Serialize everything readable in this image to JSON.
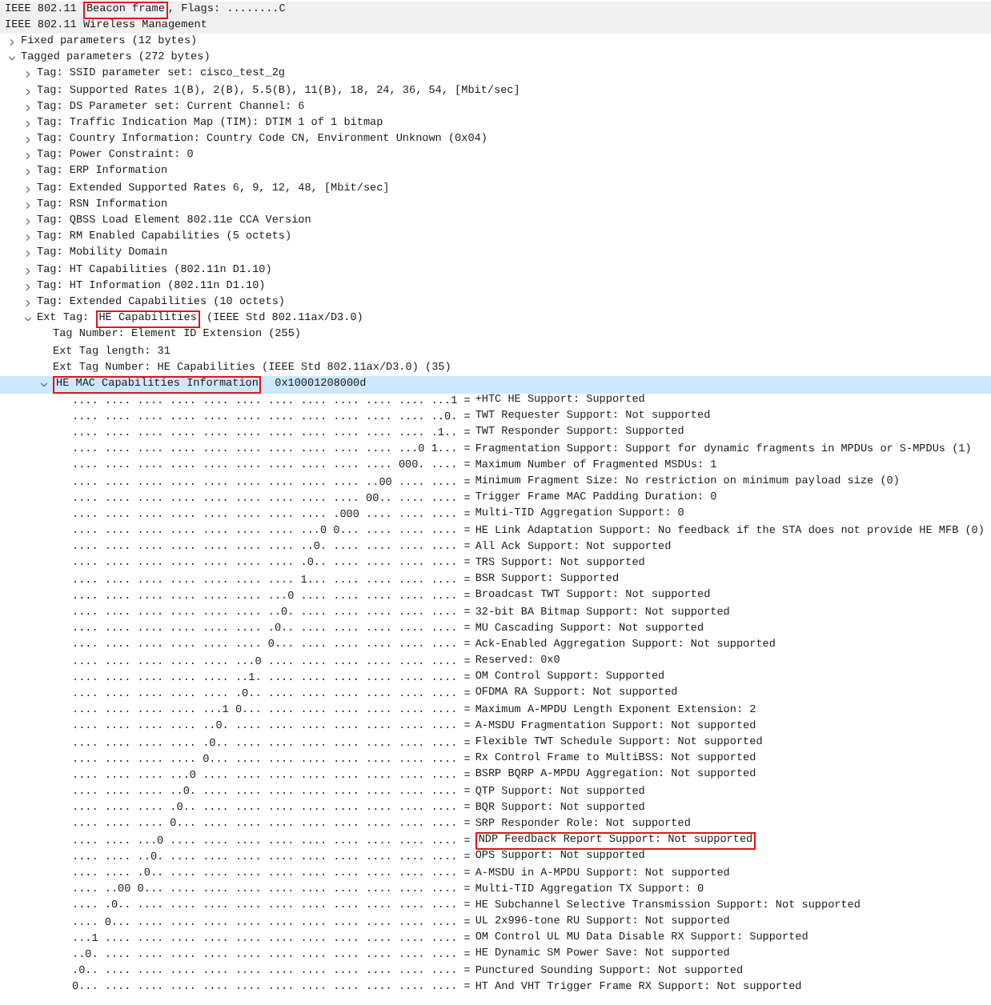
{
  "headers": [
    {
      "shaded": true,
      "parts": [
        {
          "text": "IEEE 802.11 ",
          "boxed": false
        },
        {
          "text": "Beacon frame",
          "boxed": true
        },
        {
          "text": ", Flags: ........C",
          "boxed": false
        }
      ]
    },
    {
      "shaded": true,
      "parts": [
        {
          "text": "IEEE 802.11 Wireless Management",
          "boxed": false
        }
      ]
    }
  ],
  "tree": [
    {
      "selected": false,
      "expanded": false,
      "parts": [
        {
          "text": "Fixed parameters (12 bytes)",
          "boxed": false
        }
      ]
    },
    {
      "selected": false,
      "expanded": true,
      "parts": [
        {
          "text": "Tagged parameters (272 bytes)",
          "boxed": false
        }
      ],
      "children": [
        {
          "selected": false,
          "expanded": false,
          "parts": [
            {
              "text": "Tag: SSID parameter set: cisco_test_2g",
              "boxed": false
            }
          ]
        },
        {
          "selected": false,
          "expanded": false,
          "parts": [
            {
              "text": "Tag: Supported Rates 1(B), 2(B), 5.5(B), 11(B), 18, 24, 36, 54, [Mbit/sec]",
              "boxed": false
            }
          ]
        },
        {
          "selected": false,
          "expanded": false,
          "parts": [
            {
              "text": "Tag: DS Parameter set: Current Channel: 6",
              "boxed": false
            }
          ]
        },
        {
          "selected": false,
          "expanded": false,
          "parts": [
            {
              "text": "Tag: Traffic Indication Map (TIM): DTIM 1 of 1 bitmap",
              "boxed": false
            }
          ]
        },
        {
          "selected": false,
          "expanded": false,
          "parts": [
            {
              "text": "Tag: Country Information: Country Code CN, Environment Unknown (0x04)",
              "boxed": false
            }
          ]
        },
        {
          "selected": false,
          "expanded": false,
          "parts": [
            {
              "text": "Tag: Power Constraint: 0",
              "boxed": false
            }
          ]
        },
        {
          "selected": false,
          "expanded": false,
          "parts": [
            {
              "text": "Tag: ERP Information",
              "boxed": false
            }
          ]
        },
        {
          "selected": false,
          "expanded": false,
          "parts": [
            {
              "text": "Tag: Extended Supported Rates 6, 9, 12, 48, [Mbit/sec]",
              "boxed": false
            }
          ]
        },
        {
          "selected": false,
          "expanded": false,
          "parts": [
            {
              "text": "Tag: RSN Information",
              "boxed": false
            }
          ]
        },
        {
          "selected": false,
          "expanded": false,
          "parts": [
            {
              "text": "Tag: QBSS Load Element 802.11e CCA Version",
              "boxed": false
            }
          ]
        },
        {
          "selected": false,
          "expanded": false,
          "parts": [
            {
              "text": "Tag: RM Enabled Capabilities (5 octets)",
              "boxed": false
            }
          ]
        },
        {
          "selected": false,
          "expanded": false,
          "parts": [
            {
              "text": "Tag: Mobility Domain",
              "boxed": false
            }
          ]
        },
        {
          "selected": false,
          "expanded": false,
          "parts": [
            {
              "text": "Tag: HT Capabilities (802.11n D1.10)",
              "boxed": false
            }
          ]
        },
        {
          "selected": false,
          "expanded": false,
          "parts": [
            {
              "text": "Tag: HT Information (802.11n D1.10)",
              "boxed": false
            }
          ]
        },
        {
          "selected": false,
          "expanded": false,
          "parts": [
            {
              "text": "Tag: Extended Capabilities (10 octets)",
              "boxed": false
            }
          ]
        },
        {
          "selected": false,
          "expanded": true,
          "parts": [
            {
              "text": "Ext Tag: ",
              "boxed": false
            },
            {
              "text": "HE Capabilities",
              "boxed": true
            },
            {
              "text": " (IEEE Std 802.11ax/D3.0)",
              "boxed": false
            }
          ],
          "children": [
            {
              "selected": false,
              "parts": [
                {
                  "text": "Tag Number: Element ID Extension (255)",
                  "boxed": false
                }
              ]
            },
            {
              "selected": false,
              "parts": [
                {
                  "text": "Ext Tag length: 31",
                  "boxed": false
                }
              ]
            },
            {
              "selected": false,
              "parts": [
                {
                  "text": "Ext Tag Number: HE Capabilities (IEEE Std 802.11ax/D3.0) (35)",
                  "boxed": false
                }
              ]
            },
            {
              "selected": true,
              "expanded": true,
              "parts": [
                {
                  "text": "HE MAC Capabilities Information",
                  "boxed": true
                },
                {
                  "text": "  0x10001208000d",
                  "boxed": false
                }
              ],
              "bits": [
                {
                  "selected": false,
                  "bits": ".... .... .... .... .... .... .... .... .... .... .... ...1 =",
                  "field": "+HTC HE Support: Supported",
                  "boxed": false
                },
                {
                  "selected": false,
                  "bits": ".... .... .... .... .... .... .... .... .... .... .... ..0. =",
                  "field": "TWT Requester Support: Not supported",
                  "boxed": false
                },
                {
                  "selected": false,
                  "bits": ".... .... .... .... .... .... .... .... .... .... .... .1.. =",
                  "field": "TWT Responder Support: Supported",
                  "boxed": false
                },
                {
                  "selected": false,
                  "bits": ".... .... .... .... .... .... .... .... .... .... ...0 1... =",
                  "field": "Fragmentation Support: Support for dynamic fragments in MPDUs or S-MPDUs (1)",
                  "boxed": false
                },
                {
                  "selected": false,
                  "bits": ".... .... .... .... .... .... .... .... .... .... 000. .... =",
                  "field": "Maximum Number of Fragmented MSDUs: 1",
                  "boxed": false
                },
                {
                  "selected": false,
                  "bits": ".... .... .... .... .... .... .... .... .... ..00 .... .... =",
                  "field": "Minimum Fragment Size: No restriction on minimum payload size (0)",
                  "boxed": false
                },
                {
                  "selected": false,
                  "bits": ".... .... .... .... .... .... .... .... .... 00.. .... .... =",
                  "field": "Trigger Frame MAC Padding Duration: 0",
                  "boxed": false
                },
                {
                  "selected": false,
                  "bits": ".... .... .... .... .... .... .... .... .000 .... .... .... =",
                  "field": "Multi-TID Aggregation Support: 0",
                  "boxed": false
                },
                {
                  "selected": false,
                  "bits": ".... .... .... .... .... .... .... ...0 0... .... .... .... =",
                  "field": "HE Link Adaptation Support: No feedback if the STA does not provide HE MFB (0)",
                  "boxed": false
                },
                {
                  "selected": false,
                  "bits": ".... .... .... .... .... .... .... ..0. .... .... .... .... =",
                  "field": "All Ack Support: Not supported",
                  "boxed": false
                },
                {
                  "selected": false,
                  "bits": ".... .... .... .... .... .... .... .0.. .... .... .... .... =",
                  "field": "TRS Support: Not supported",
                  "boxed": false
                },
                {
                  "selected": false,
                  "bits": ".... .... .... .... .... .... .... 1... .... .... .... .... =",
                  "field": "BSR Support: Supported",
                  "boxed": false
                },
                {
                  "selected": false,
                  "bits": ".... .... .... .... .... .... ...0 .... .... .... .... .... =",
                  "field": "Broadcast TWT Support: Not supported",
                  "boxed": false
                },
                {
                  "selected": false,
                  "bits": ".... .... .... .... .... .... ..0. .... .... .... .... .... =",
                  "field": "32-bit BA Bitmap Support: Not supported",
                  "boxed": false
                },
                {
                  "selected": false,
                  "bits": ".... .... .... .... .... .... .0.. .... .... .... .... .... =",
                  "field": "MU Cascading Support: Not supported",
                  "boxed": false
                },
                {
                  "selected": false,
                  "bits": ".... .... .... .... .... .... 0... .... .... .... .... .... =",
                  "field": "Ack-Enabled Aggregation Support: Not supported",
                  "boxed": false
                },
                {
                  "selected": false,
                  "bits": ".... .... .... .... .... ...0 .... .... .... .... .... .... =",
                  "field": "Reserved: 0x0",
                  "boxed": false
                },
                {
                  "selected": false,
                  "bits": ".... .... .... .... .... ..1. .... .... .... .... .... .... =",
                  "field": "OM Control Support: Supported",
                  "boxed": false
                },
                {
                  "selected": false,
                  "bits": ".... .... .... .... .... .0.. .... .... .... .... .... .... =",
                  "field": "OFDMA RA Support: Not supported",
                  "boxed": false
                },
                {
                  "selected": false,
                  "bits": ".... .... .... .... ...1 0... .... .... .... .... .... .... =",
                  "field": "Maximum A-MPDU Length Exponent Extension: 2",
                  "boxed": false
                },
                {
                  "selected": false,
                  "bits": ".... .... .... .... ..0. .... .... .... .... .... .... .... =",
                  "field": "A-MSDU Fragmentation Support: Not supported",
                  "boxed": false
                },
                {
                  "selected": false,
                  "bits": ".... .... .... .... .0.. .... .... .... .... .... .... .... =",
                  "field": "Flexible TWT Schedule Support: Not supported",
                  "boxed": false
                },
                {
                  "selected": false,
                  "bits": ".... .... .... .... 0... .... .... .... .... .... .... .... =",
                  "field": "Rx Control Frame to MultiBSS: Not supported",
                  "boxed": false
                },
                {
                  "selected": false,
                  "bits": ".... .... .... ...0 .... .... .... .... .... .... .... .... =",
                  "field": "BSRP BQRP A-MPDU Aggregation: Not supported",
                  "boxed": false
                },
                {
                  "selected": false,
                  "bits": ".... .... .... ..0. .... .... .... .... .... .... .... .... =",
                  "field": "QTP Support: Not supported",
                  "boxed": false
                },
                {
                  "selected": false,
                  "bits": ".... .... .... .0.. .... .... .... .... .... .... .... .... =",
                  "field": "BQR Support: Not supported",
                  "boxed": false
                },
                {
                  "selected": false,
                  "bits": ".... .... .... 0... .... .... .... .... .... .... .... .... =",
                  "field": "SRP Responder Role: Not supported",
                  "boxed": false
                },
                {
                  "selected": false,
                  "bits": ".... .... ...0 .... .... .... .... .... .... .... .... .... =",
                  "field": "NDP Feedback Report Support: Not supported",
                  "boxed": true
                },
                {
                  "selected": false,
                  "bits": ".... .... ..0. .... .... .... .... .... .... .... .... .... =",
                  "field": "OPS Support: Not supported",
                  "boxed": false
                },
                {
                  "selected": false,
                  "bits": ".... .... .0.. .... .... .... .... .... .... .... .... .... =",
                  "field": "A-MSDU in A-MPDU Support: Not supported",
                  "boxed": false
                },
                {
                  "selected": false,
                  "bits": ".... ..00 0... .... .... .... .... .... .... .... .... .... =",
                  "field": "Multi-TID Aggregation TX Support: 0",
                  "boxed": false
                },
                {
                  "selected": false,
                  "bits": ".... .0.. .... .... .... .... .... .... .... .... .... .... =",
                  "field": "HE Subchannel Selective Transmission Support: Not supported",
                  "boxed": false
                },
                {
                  "selected": false,
                  "bits": ".... 0... .... .... .... .... .... .... .... .... .... .... =",
                  "field": "UL 2x996-tone RU Support: Not supported",
                  "boxed": false
                },
                {
                  "selected": false,
                  "bits": "...1 .... .... .... .... .... .... .... .... .... .... .... =",
                  "field": "OM Control UL MU Data Disable RX Support: Supported",
                  "boxed": false
                },
                {
                  "selected": false,
                  "bits": "..0. .... .... .... .... .... .... .... .... .... .... .... =",
                  "field": "HE Dynamic SM Power Save: Not supported",
                  "boxed": false
                },
                {
                  "selected": false,
                  "bits": ".0.. .... .... .... .... .... .... .... .... .... .... .... =",
                  "field": "Punctured Sounding Support: Not supported",
                  "boxed": false
                },
                {
                  "selected": false,
                  "bits": "0... .... .... .... .... .... .... .... .... .... .... .... =",
                  "field": "HT And VHT Trigger Frame RX Support: Not supported",
                  "boxed": false
                }
              ]
            }
          ]
        }
      ]
    }
  ]
}
